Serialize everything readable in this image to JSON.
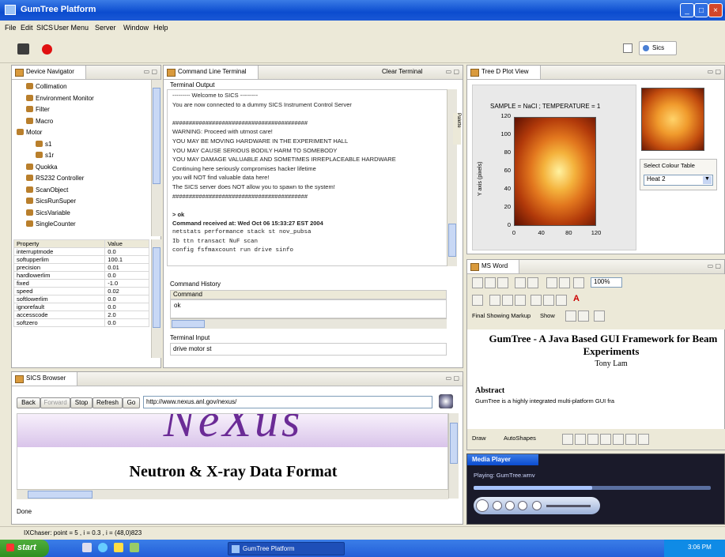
{
  "window": {
    "title": "GumTree Platform",
    "min": "_",
    "max": "□",
    "close": "×"
  },
  "menu": [
    "File",
    "Edit",
    "SICS",
    "User Menu",
    "Server",
    "Window",
    "Help"
  ],
  "toolbar": {
    "perspective_label": "Sics",
    "icons": [
      "save-icon",
      "record-icon"
    ]
  },
  "device_navigator": {
    "tab": "Device Navigator",
    "items": [
      {
        "label": "Collimation",
        "indent": 1
      },
      {
        "label": "Environment Monitor",
        "indent": 1
      },
      {
        "label": "Filter",
        "indent": 1
      },
      {
        "label": "Macro",
        "indent": 1
      },
      {
        "label": "Motor",
        "indent": 0
      },
      {
        "label": "s1",
        "indent": 2
      },
      {
        "label": "s1r",
        "indent": 2
      },
      {
        "label": "Quokka",
        "indent": 1
      },
      {
        "label": "RS232 Controller",
        "indent": 1
      },
      {
        "label": "ScanObject",
        "indent": 1
      },
      {
        "label": "SicsRunSuper",
        "indent": 1
      },
      {
        "label": "SicsVariable",
        "indent": 1
      },
      {
        "label": "SingleCounter",
        "indent": 1
      }
    ],
    "props_headers": [
      "Property",
      "Value"
    ],
    "props": [
      [
        "interruptmode",
        "0.0"
      ],
      [
        "softupperlim",
        "100.1"
      ],
      [
        "precision",
        "0.01"
      ],
      [
        "hardlowerlim",
        "0.0"
      ],
      [
        "fixed",
        "-1.0"
      ],
      [
        "speed",
        "0.02"
      ],
      [
        "softlowerlim",
        "0.0"
      ],
      [
        "ignorefault",
        "0.0"
      ],
      [
        "accesscode",
        "2.0"
      ],
      [
        "softzero",
        "0.0"
      ]
    ]
  },
  "terminal": {
    "tab": "Command Line Terminal",
    "clear_label": "Clear Terminal",
    "output_label": "Terminal Output",
    "lines": [
      "--------- Welcome to SICS ---------",
      "You are now connected to a dummy SICS Instrument Control Server",
      "",
      "#########################################",
      "WARNING: Proceed with utmost care!",
      "YOU MAY BE MOVING HARDWARE IN THE EXPERIMENT HALL",
      "YOU MAY CAUSE SERIOUS BODILY HARM TO SOMEBODY",
      "YOU MAY DAMAGE VALUABLE AND SOMETIMES IRREPLACEABLE HARDWARE",
      "Continuing here seriously compromises hacker lifetime",
      "you will NOT find valuable data here!",
      "The SICS server does NOT allow you to spawn to the system!",
      "#########################################",
      "",
      "> ok",
      "Command received at: Wed Oct 06 15:33:27 EST 2004",
      "netstats  performance  stack  st  nov_pubsa",
      "Ib  ttn  transact  NuF  scan",
      "config  fsfmaxcount  run  drive  sinfo"
    ],
    "history_label": "Command History",
    "history_header": "Command",
    "history_items": [
      "ok"
    ],
    "input_label": "Terminal Input",
    "input_value": "drive motor st"
  },
  "plot_view": {
    "tab": "Tree D Plot View",
    "title": "SAMPLE = NaCl ; TEMPERATURE = 1",
    "y_label": "Y axis (pixels)",
    "x_ticks": [
      "0",
      "40",
      "80",
      "120"
    ],
    "y_ticks": [
      "0",
      "20",
      "40",
      "60",
      "80",
      "100",
      "120"
    ],
    "colour_label": "Select Colour Table",
    "colour_value": "Heat 2"
  },
  "ms_word": {
    "tab": "MS Word",
    "zoom": "100%",
    "review_label": "Final Showing Markup",
    "show_label": "Show",
    "autoshapes_label": "AutoShapes",
    "draw_label": "Draw",
    "doc_title": "GumTree - A Java Based GUI Framework for Beamline Experiments",
    "author": "Tony Lam",
    "abstract_heading": "Abstract",
    "abstract_text": "GumTree is a highly integrated multi-platform GUI fra"
  },
  "media_player": {
    "tab": "Media Player",
    "status": "Playing: GumTree.wmv"
  },
  "sics_browser": {
    "tab": "SICS Browser",
    "back": "Back",
    "forward": "Forward",
    "stop": "Stop",
    "refresh": "Refresh",
    "go": "Go",
    "url": "http://www.nexus.anl.gov/nexus/",
    "banner_text": "NeXus",
    "subtitle": "Neutron & X-ray Data Format",
    "status": "Done"
  },
  "status_bar": {
    "text": "IXChaser: point = 5 , i = 0.3 , i = (48,0)823"
  },
  "taskbar": {
    "start": "start",
    "task": "GumTree Platform",
    "clock": "3:06 PM"
  }
}
